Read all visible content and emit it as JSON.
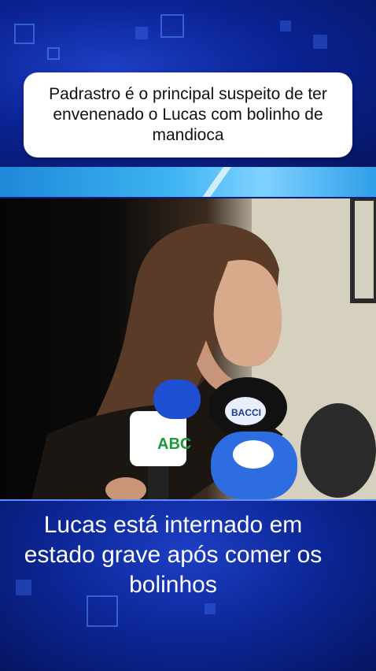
{
  "headline": {
    "text": "Padrastro é o principal suspeito de ter envenenado o Lucas com bolinho de mandioca"
  },
  "photo": {
    "description_icon": "reporter-photo",
    "microphone_labels": [
      "ABC",
      "BACCI"
    ]
  },
  "caption": {
    "text": "Lucas está internado em estado grave após comer os bolinhos"
  },
  "colors": {
    "background": "#0b2395",
    "headline_box": "#ffffff",
    "stripe": "#3db3f2",
    "caption_text": "#ffffff"
  }
}
